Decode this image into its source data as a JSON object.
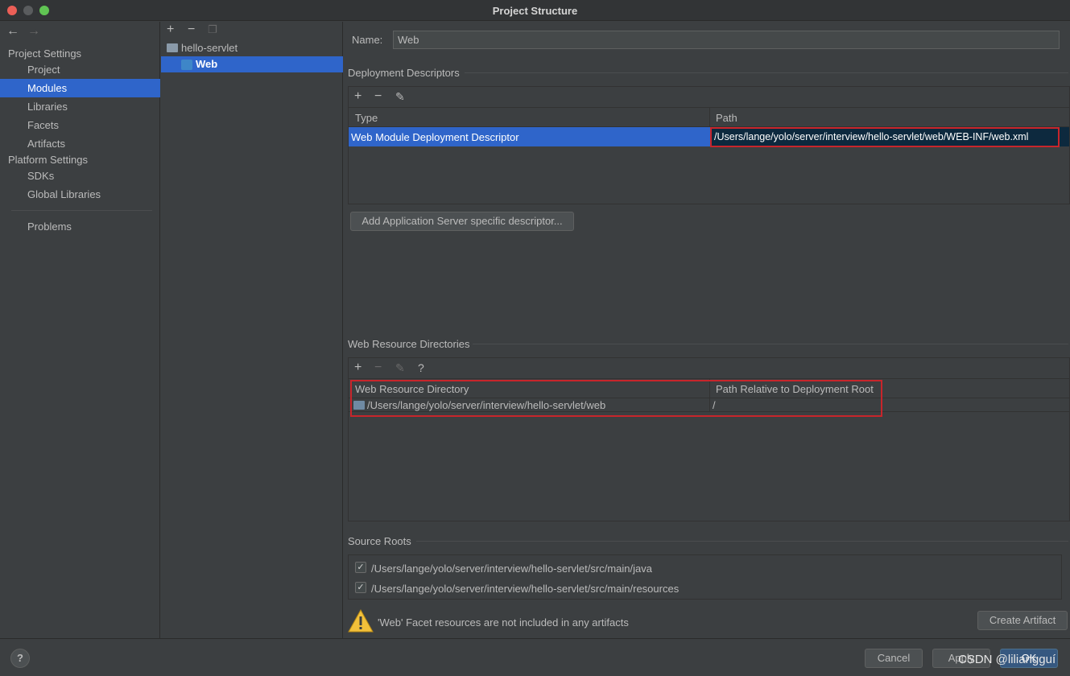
{
  "window": {
    "title": "Project Structure"
  },
  "nav": {
    "project_settings_header": "Project Settings",
    "project_settings_items": [
      "Project",
      "Modules",
      "Libraries",
      "Facets",
      "Artifacts"
    ],
    "platform_settings_header": "Platform Settings",
    "platform_settings_items": [
      "SDKs",
      "Global Libraries"
    ],
    "problems": "Problems",
    "selected": "Modules"
  },
  "tree": {
    "root": "hello-servlet",
    "child": "Web"
  },
  "form": {
    "name_label": "Name:",
    "name_value": "Web"
  },
  "deployment": {
    "title": "Deployment Descriptors",
    "col_type": "Type",
    "col_path": "Path",
    "row_type": "Web Module Deployment Descriptor",
    "row_path": "/Users/lange/yolo/server/interview/hello-servlet/web/WEB-INF/web.xml",
    "add_button": "Add Application Server specific descriptor..."
  },
  "resources": {
    "title": "Web Resource Directories",
    "help": "?",
    "col_dir": "Web Resource Directory",
    "col_rel": "Path Relative to Deployment Root",
    "row_dir": "/Users/lange/yolo/server/interview/hello-servlet/web",
    "row_rel": "/"
  },
  "sources": {
    "title": "Source Roots",
    "items": [
      "/Users/lange/yolo/server/interview/hello-servlet/src/main/java",
      "/Users/lange/yolo/server/interview/hello-servlet/src/main/resources"
    ]
  },
  "warning": {
    "text": "'Web' Facet resources are not included in any artifacts",
    "button": "Create Artifact"
  },
  "footer": {
    "help": "?",
    "cancel": "Cancel",
    "apply": "Apply",
    "ok": "OK",
    "watermark": "CSDN @liliangguí"
  },
  "icons": {
    "back": "arrow-left-icon",
    "forward": "arrow-right-icon",
    "add": "plus-icon",
    "remove": "minus-icon",
    "copy": "copy-icon",
    "edit": "pencil-icon",
    "warning": "warning-icon",
    "check": "checkmark-icon"
  },
  "colors": {
    "selection": "#2f65ca",
    "highlight_box": "#c8252b",
    "background": "#3c3f41"
  }
}
